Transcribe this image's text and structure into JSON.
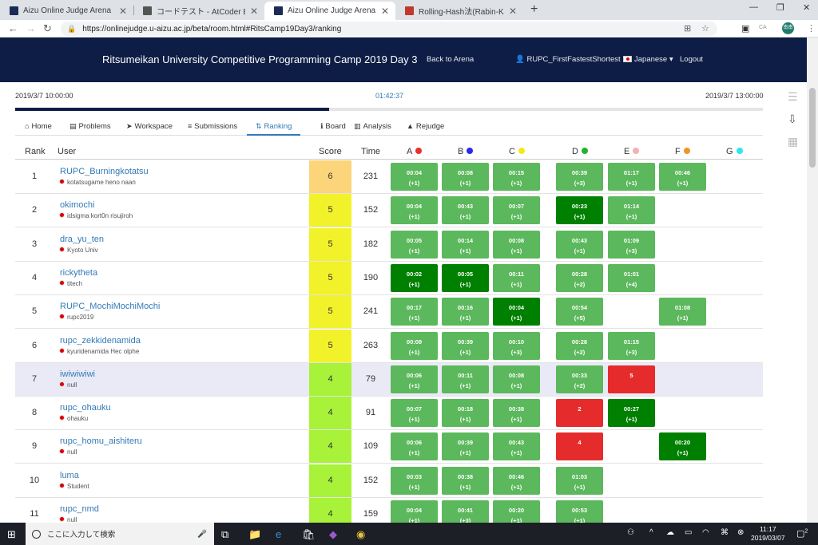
{
  "browser": {
    "tabs": [
      {
        "title": "Aizu Online Judge Arena",
        "fav": "#1a2b55",
        "active": false
      },
      {
        "title": "コードテスト - AtCoder Beginner Co",
        "fav": "#555555",
        "active": false
      },
      {
        "title": "Aizu Online Judge Arena",
        "fav": "#1a2b55",
        "active": true
      },
      {
        "title": "Rolling-Hash法(Rabin-Karp法) - ",
        "fav": "#c0392b",
        "active": false
      }
    ],
    "new_tab": "+",
    "url": "https://onlinejudge.u-aizu.ac.jp/beta/room.html#RitsCamp19Day3/ranking",
    "profile_initials": "南南",
    "ext_label": "CA"
  },
  "site": {
    "title": "Ritsumeikan University Competitive Programming Camp 2019 Day 3",
    "back": "Back to Arena",
    "user": "RUPC_FirstFastestShortest",
    "language": "Japanese",
    "logout": "Logout"
  },
  "timer": {
    "start": "2019/3/7 10:00:00",
    "elapsed": "01:42:37",
    "end": "2019/3/7 13:00:00",
    "progress": 0.42
  },
  "nav": [
    {
      "label": "Home",
      "icon": "⌂"
    },
    {
      "label": "Problems",
      "icon": "▤"
    },
    {
      "label": "Workspace",
      "icon": "➤"
    },
    {
      "label": "Submissions",
      "icon": "≡"
    },
    {
      "label": "Ranking",
      "icon": "⇅"
    },
    {
      "label": "Board",
      "icon": "ℹ"
    },
    {
      "label": "Analysis",
      "icon": "▥"
    },
    {
      "label": "Rejudge",
      "icon": "▲"
    }
  ],
  "table": {
    "headers": {
      "rank": "Rank",
      "user": "User",
      "score": "Score",
      "time": "Time"
    },
    "problems": [
      {
        "id": "A",
        "color": "#e8302a"
      },
      {
        "id": "B",
        "color": "#2a2ae8"
      },
      {
        "id": "C",
        "color": "#f2ea1c"
      },
      {
        "id": "D",
        "color": "#22b32e"
      },
      {
        "id": "E",
        "color": "#f5b0b0"
      },
      {
        "id": "F",
        "color": "#f0932b"
      },
      {
        "id": "G",
        "color": "#2fe6f0"
      }
    ],
    "rows": [
      {
        "rank": "1",
        "user": "RUPC_Burningkotatsu",
        "aff": "kotatsugame heno naan",
        "score": "6",
        "time": "231",
        "score_color": "#fcd57a",
        "hl": false,
        "cells": [
          {
            "t": "ac",
            "a": "00:04",
            "b": "(+1)"
          },
          {
            "t": "ac",
            "a": "00:08",
            "b": "(+1)"
          },
          {
            "t": "ac",
            "a": "00:15",
            "b": "(+1)"
          },
          {
            "t": "ac",
            "a": "00:39",
            "b": "(+3)"
          },
          {
            "t": "ac",
            "a": "01:17",
            "b": "(+1)"
          },
          {
            "t": "ac",
            "a": "00:46",
            "b": "(+1)"
          },
          null
        ]
      },
      {
        "rank": "2",
        "user": "okimochi",
        "aff": "idsigma kort0n risujiroh",
        "score": "5",
        "time": "152",
        "score_color": "#f2f22a",
        "hl": false,
        "cells": [
          {
            "t": "ac",
            "a": "00:04",
            "b": "(+1)"
          },
          {
            "t": "ac",
            "a": "00:43",
            "b": "(+1)"
          },
          {
            "t": "ac",
            "a": "00:07",
            "b": "(+1)"
          },
          {
            "t": "first",
            "a": "00:23",
            "b": "(+1)"
          },
          {
            "t": "ac",
            "a": "01:14",
            "b": "(+1)"
          },
          null,
          null
        ]
      },
      {
        "rank": "3",
        "user": "dra_yu_ten",
        "aff": "Kyoto Univ",
        "score": "5",
        "time": "182",
        "score_color": "#f2f22a",
        "hl": false,
        "cells": [
          {
            "t": "ac",
            "a": "00:05",
            "b": "(+1)"
          },
          {
            "t": "ac",
            "a": "00:14",
            "b": "(+1)"
          },
          {
            "t": "ac",
            "a": "00:08",
            "b": "(+1)"
          },
          {
            "t": "ac",
            "a": "00:43",
            "b": "(+1)"
          },
          {
            "t": "ac",
            "a": "01:09",
            "b": "(+3)"
          },
          null,
          null
        ]
      },
      {
        "rank": "4",
        "user": "rickytheta",
        "aff": "titech",
        "score": "5",
        "time": "190",
        "score_color": "#f2f22a",
        "hl": false,
        "cells": [
          {
            "t": "first",
            "a": "00:02",
            "b": "(+1)"
          },
          {
            "t": "first",
            "a": "00:05",
            "b": "(+1)"
          },
          {
            "t": "ac",
            "a": "00:11",
            "b": "(+1)"
          },
          {
            "t": "ac",
            "a": "00:28",
            "b": "(+2)"
          },
          {
            "t": "ac",
            "a": "01:01",
            "b": "(+4)"
          },
          null,
          null
        ]
      },
      {
        "rank": "5",
        "user": "RUPC_MochiMochiMochi",
        "aff": "rupc2019",
        "score": "5",
        "time": "241",
        "score_color": "#f2f22a",
        "hl": false,
        "cells": [
          {
            "t": "ac",
            "a": "00:17",
            "b": "(+1)"
          },
          {
            "t": "ac",
            "a": "00:16",
            "b": "(+1)"
          },
          {
            "t": "first",
            "a": "00:04",
            "b": "(+1)"
          },
          {
            "t": "ac",
            "a": "00:54",
            "b": "(+5)"
          },
          null,
          {
            "t": "ac",
            "a": "01:08",
            "b": "(+1)"
          },
          null
        ]
      },
      {
        "rank": "6",
        "user": "rupc_zekkidenamida",
        "aff": "kyuridenamida Hec olphe",
        "score": "5",
        "time": "263",
        "score_color": "#f2f22a",
        "hl": false,
        "cells": [
          {
            "t": "ac",
            "a": "00:09",
            "b": "(+1)"
          },
          {
            "t": "ac",
            "a": "00:39",
            "b": "(+1)"
          },
          {
            "t": "ac",
            "a": "00:10",
            "b": "(+3)"
          },
          {
            "t": "ac",
            "a": "00:28",
            "b": "(+2)"
          },
          {
            "t": "ac",
            "a": "01:15",
            "b": "(+3)"
          },
          null,
          null
        ]
      },
      {
        "rank": "7",
        "user": "iwiwiwiwi",
        "aff": "null",
        "score": "4",
        "time": "79",
        "score_color": "#a8f23a",
        "hl": true,
        "cells": [
          {
            "t": "ac",
            "a": "00:06",
            "b": "(+1)"
          },
          {
            "t": "ac",
            "a": "00:11",
            "b": "(+1)"
          },
          {
            "t": "ac",
            "a": "00:08",
            "b": "(+1)"
          },
          {
            "t": "ac",
            "a": "00:33",
            "b": "(+2)"
          },
          {
            "t": "wa",
            "a": "5",
            "b": ""
          },
          null,
          null
        ]
      },
      {
        "rank": "8",
        "user": "rupc_ohauku",
        "aff": "ohauku",
        "score": "4",
        "time": "91",
        "score_color": "#a8f23a",
        "hl": false,
        "cells": [
          {
            "t": "ac",
            "a": "00:07",
            "b": "(+1)"
          },
          {
            "t": "ac",
            "a": "00:18",
            "b": "(+1)"
          },
          {
            "t": "ac",
            "a": "00:38",
            "b": "(+1)"
          },
          {
            "t": "wa",
            "a": "2",
            "b": ""
          },
          {
            "t": "first",
            "a": "00:27",
            "b": "(+1)"
          },
          null,
          null
        ]
      },
      {
        "rank": "9",
        "user": "rupc_homu_aishiteru",
        "aff": "null",
        "score": "4",
        "time": "109",
        "score_color": "#a8f23a",
        "hl": false,
        "cells": [
          {
            "t": "ac",
            "a": "00:06",
            "b": "(+1)"
          },
          {
            "t": "ac",
            "a": "00:39",
            "b": "(+1)"
          },
          {
            "t": "ac",
            "a": "00:43",
            "b": "(+1)"
          },
          {
            "t": "wa",
            "a": "4",
            "b": ""
          },
          null,
          {
            "t": "first",
            "a": "00:20",
            "b": "(+1)"
          },
          null
        ]
      },
      {
        "rank": "10",
        "user": "luma",
        "aff": "Student",
        "score": "4",
        "time": "152",
        "score_color": "#a8f23a",
        "hl": false,
        "cells": [
          {
            "t": "ac",
            "a": "00:03",
            "b": "(+1)"
          },
          {
            "t": "ac",
            "a": "00:38",
            "b": "(+1)"
          },
          {
            "t": "ac",
            "a": "00:46",
            "b": "(+1)"
          },
          {
            "t": "ac",
            "a": "01:03",
            "b": "(+1)"
          },
          null,
          null,
          null
        ]
      },
      {
        "rank": "11",
        "user": "rupc_nmd",
        "aff": "null",
        "score": "4",
        "time": "159",
        "score_color": "#a8f23a",
        "hl": false,
        "cells": [
          {
            "t": "ac",
            "a": "00:04",
            "b": "(+1)"
          },
          {
            "t": "ac",
            "a": "00:41",
            "b": "(+3)"
          },
          {
            "t": "ac",
            "a": "00:20",
            "b": "(+1)"
          },
          {
            "t": "ac",
            "a": "00:53",
            "b": "(+1)"
          },
          null,
          null,
          null
        ]
      }
    ]
  },
  "taskbar": {
    "search_placeholder": "ここに入力して検索",
    "time": "11:17",
    "date": "2019/03/07",
    "notifications": "2"
  }
}
